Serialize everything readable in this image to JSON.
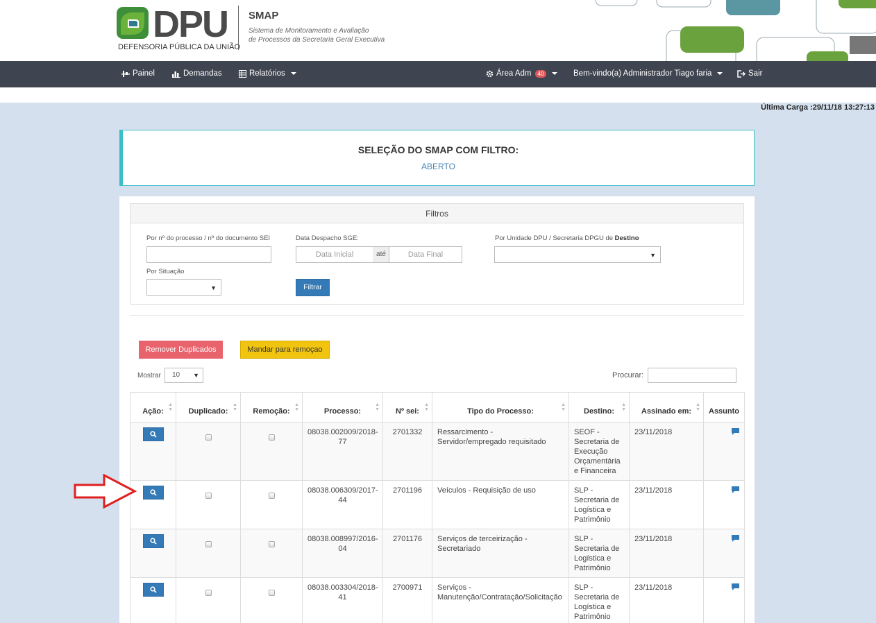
{
  "header": {
    "logo_text": "DPU",
    "logo_subtitle": "DEFENSORIA PÚBLICA DA UNIÃO",
    "app_name": "SMAP",
    "app_description_line1": "Sistema de Monitoramento e Avaliação",
    "app_description_line2": "de Processos da Secretaria Geral Executiva"
  },
  "navbar": {
    "painel": "Painel",
    "demandas": "Demandas",
    "relatorios": "Relatórios",
    "area_adm": "Área Adm",
    "area_adm_badge": "40",
    "welcome": "Bem-vindo(a) Administrador Tiago faria",
    "logout": "Sair"
  },
  "last_load": "Última Carga :29/11/18 13:27:13",
  "title_panel": {
    "title": "SELEÇÃO DO SMAP COM FILTRO:",
    "status": "ABERTO"
  },
  "filters": {
    "heading": "Filtros",
    "process_label": "Por nº do processo / nº do documento SEI",
    "process_value": "",
    "dispatch_label": "Data Despacho SGE:",
    "date_start_placeholder": "Data Inicial",
    "date_connector": "até",
    "date_end_placeholder": "Data Final",
    "unit_label_prefix": "Por Unidade DPU / Secretaria DPGU de ",
    "unit_label_bold": "Destino",
    "unit_value": "",
    "situation_label": "Por Situação",
    "situation_value": "",
    "filter_button": "Filtrar"
  },
  "actions": {
    "remove_duplicates": "Remover Duplicados",
    "send_removal": "Mandar para remoçao"
  },
  "table_controls": {
    "show_label": "Mostrar",
    "show_value": "10",
    "search_label": "Procurar:",
    "search_value": ""
  },
  "table": {
    "headers": [
      "Ação:",
      "Duplicado:",
      "Remoção:",
      "Processo:",
      "Nº sei:",
      "Tipo do Processo:",
      "Destino:",
      "Assinado em:",
      "Assunto"
    ],
    "rows": [
      {
        "processo": "08038.002009/2018-77",
        "sei": "2701332",
        "tipo": "Ressarcimento - Servidor/empregado requisitado",
        "destino": "SEOF - Secretaria de Execução Orçamentária e Financeira",
        "assinado": "23/11/2018"
      },
      {
        "processo": "08038.006309/2017-44",
        "sei": "2701196",
        "tipo": "Veículos - Requisição de uso",
        "destino": "SLP - Secretaria de Logística e Patrimônio",
        "assinado": "23/11/2018"
      },
      {
        "processo": "08038.008997/2016-04",
        "sei": "2701176",
        "tipo": "Serviços de terceirização - Secretariado",
        "destino": "SLP - Secretaria de Logística e Patrimônio",
        "assinado": "23/11/2018"
      },
      {
        "processo": "08038.003304/2018-41",
        "sei": "2700971",
        "tipo": "Serviços - Manutenção/Contratação/Solicitação",
        "destino": "SLP - Secretaria de Logística e Patrimônio",
        "assinado": "23/11/2018"
      }
    ]
  },
  "colors": {
    "navbar": "#3f4550",
    "primary_button": "#337ab7",
    "danger_button": "#e8636c",
    "warning_button": "#f1c40f",
    "panel_accent": "#3bbfc7",
    "annotation_arrow": "#e02020"
  }
}
